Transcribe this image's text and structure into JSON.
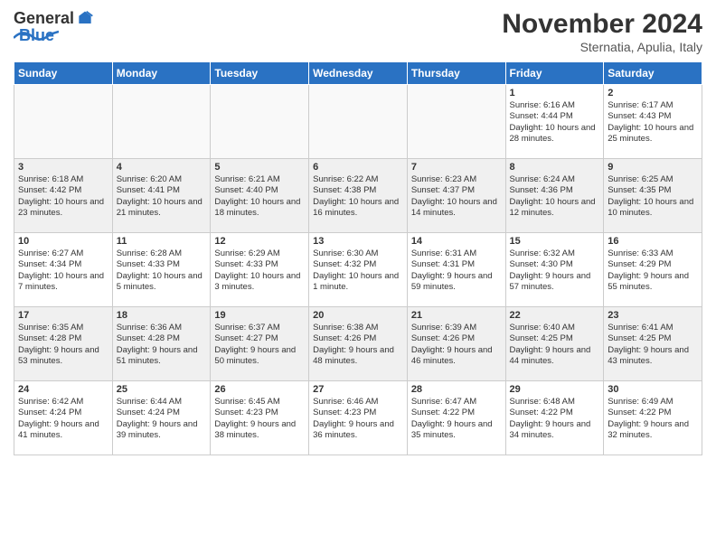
{
  "header": {
    "logo_general": "General",
    "logo_blue": "Blue",
    "title": "November 2024",
    "location": "Sternatia, Apulia, Italy"
  },
  "weekdays": [
    "Sunday",
    "Monday",
    "Tuesday",
    "Wednesday",
    "Thursday",
    "Friday",
    "Saturday"
  ],
  "weeks": [
    [
      {
        "day": "",
        "info": ""
      },
      {
        "day": "",
        "info": ""
      },
      {
        "day": "",
        "info": ""
      },
      {
        "day": "",
        "info": ""
      },
      {
        "day": "",
        "info": ""
      },
      {
        "day": "1",
        "info": "Sunrise: 6:16 AM\nSunset: 4:44 PM\nDaylight: 10 hours and 28 minutes."
      },
      {
        "day": "2",
        "info": "Sunrise: 6:17 AM\nSunset: 4:43 PM\nDaylight: 10 hours and 25 minutes."
      }
    ],
    [
      {
        "day": "3",
        "info": "Sunrise: 6:18 AM\nSunset: 4:42 PM\nDaylight: 10 hours and 23 minutes."
      },
      {
        "day": "4",
        "info": "Sunrise: 6:20 AM\nSunset: 4:41 PM\nDaylight: 10 hours and 21 minutes."
      },
      {
        "day": "5",
        "info": "Sunrise: 6:21 AM\nSunset: 4:40 PM\nDaylight: 10 hours and 18 minutes."
      },
      {
        "day": "6",
        "info": "Sunrise: 6:22 AM\nSunset: 4:38 PM\nDaylight: 10 hours and 16 minutes."
      },
      {
        "day": "7",
        "info": "Sunrise: 6:23 AM\nSunset: 4:37 PM\nDaylight: 10 hours and 14 minutes."
      },
      {
        "day": "8",
        "info": "Sunrise: 6:24 AM\nSunset: 4:36 PM\nDaylight: 10 hours and 12 minutes."
      },
      {
        "day": "9",
        "info": "Sunrise: 6:25 AM\nSunset: 4:35 PM\nDaylight: 10 hours and 10 minutes."
      }
    ],
    [
      {
        "day": "10",
        "info": "Sunrise: 6:27 AM\nSunset: 4:34 PM\nDaylight: 10 hours and 7 minutes."
      },
      {
        "day": "11",
        "info": "Sunrise: 6:28 AM\nSunset: 4:33 PM\nDaylight: 10 hours and 5 minutes."
      },
      {
        "day": "12",
        "info": "Sunrise: 6:29 AM\nSunset: 4:33 PM\nDaylight: 10 hours and 3 minutes."
      },
      {
        "day": "13",
        "info": "Sunrise: 6:30 AM\nSunset: 4:32 PM\nDaylight: 10 hours and 1 minute."
      },
      {
        "day": "14",
        "info": "Sunrise: 6:31 AM\nSunset: 4:31 PM\nDaylight: 9 hours and 59 minutes."
      },
      {
        "day": "15",
        "info": "Sunrise: 6:32 AM\nSunset: 4:30 PM\nDaylight: 9 hours and 57 minutes."
      },
      {
        "day": "16",
        "info": "Sunrise: 6:33 AM\nSunset: 4:29 PM\nDaylight: 9 hours and 55 minutes."
      }
    ],
    [
      {
        "day": "17",
        "info": "Sunrise: 6:35 AM\nSunset: 4:28 PM\nDaylight: 9 hours and 53 minutes."
      },
      {
        "day": "18",
        "info": "Sunrise: 6:36 AM\nSunset: 4:28 PM\nDaylight: 9 hours and 51 minutes."
      },
      {
        "day": "19",
        "info": "Sunrise: 6:37 AM\nSunset: 4:27 PM\nDaylight: 9 hours and 50 minutes."
      },
      {
        "day": "20",
        "info": "Sunrise: 6:38 AM\nSunset: 4:26 PM\nDaylight: 9 hours and 48 minutes."
      },
      {
        "day": "21",
        "info": "Sunrise: 6:39 AM\nSunset: 4:26 PM\nDaylight: 9 hours and 46 minutes."
      },
      {
        "day": "22",
        "info": "Sunrise: 6:40 AM\nSunset: 4:25 PM\nDaylight: 9 hours and 44 minutes."
      },
      {
        "day": "23",
        "info": "Sunrise: 6:41 AM\nSunset: 4:25 PM\nDaylight: 9 hours and 43 minutes."
      }
    ],
    [
      {
        "day": "24",
        "info": "Sunrise: 6:42 AM\nSunset: 4:24 PM\nDaylight: 9 hours and 41 minutes."
      },
      {
        "day": "25",
        "info": "Sunrise: 6:44 AM\nSunset: 4:24 PM\nDaylight: 9 hours and 39 minutes."
      },
      {
        "day": "26",
        "info": "Sunrise: 6:45 AM\nSunset: 4:23 PM\nDaylight: 9 hours and 38 minutes."
      },
      {
        "day": "27",
        "info": "Sunrise: 6:46 AM\nSunset: 4:23 PM\nDaylight: 9 hours and 36 minutes."
      },
      {
        "day": "28",
        "info": "Sunrise: 6:47 AM\nSunset: 4:22 PM\nDaylight: 9 hours and 35 minutes."
      },
      {
        "day": "29",
        "info": "Sunrise: 6:48 AM\nSunset: 4:22 PM\nDaylight: 9 hours and 34 minutes."
      },
      {
        "day": "30",
        "info": "Sunrise: 6:49 AM\nSunset: 4:22 PM\nDaylight: 9 hours and 32 minutes."
      }
    ]
  ]
}
